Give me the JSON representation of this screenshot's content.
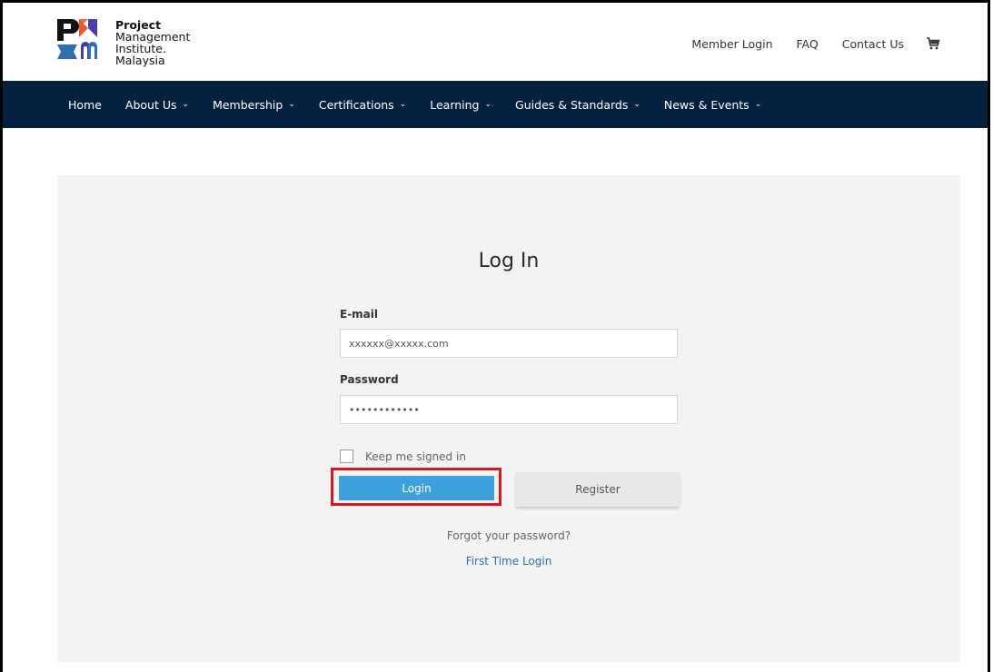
{
  "brand": {
    "lines": [
      "Project",
      "Management",
      "Institute.",
      "Malaysia"
    ],
    "colors": {
      "dark": "#121212",
      "blue": "#2f6fb3",
      "accent_orange": "#ea5a2a",
      "accent_purple": "#4b3aa9"
    }
  },
  "header_links": {
    "member_login": "Member Login",
    "faq": "FAQ",
    "contact_us": "Contact Us",
    "cart_icon": "cart-icon"
  },
  "nav": {
    "items": [
      {
        "label": "Home",
        "has_dropdown": false
      },
      {
        "label": "About Us",
        "has_dropdown": true
      },
      {
        "label": "Membership",
        "has_dropdown": true
      },
      {
        "label": "Certifications",
        "has_dropdown": true
      },
      {
        "label": "Learning",
        "has_dropdown": true
      },
      {
        "label": "Guides & Standards",
        "has_dropdown": true
      },
      {
        "label": "News & Events",
        "has_dropdown": true
      }
    ],
    "chevron": "⌄",
    "bg": "#03213f"
  },
  "login": {
    "title": "Log In",
    "email_label": "E-mail",
    "email_value": "xxxxxx@xxxxx.com",
    "password_label": "Password",
    "password_value": "••••••••••••",
    "remember_label": "Keep me signed in",
    "login_button": "Login",
    "register_button": "Register",
    "forgot_link": "Forgot your password?",
    "first_time_link": "First Time Login",
    "colors": {
      "login_button": "#3ea0dd",
      "highlight": "#e0141e",
      "panel": "#f3f3f3",
      "link": "#2f6fb3"
    }
  }
}
